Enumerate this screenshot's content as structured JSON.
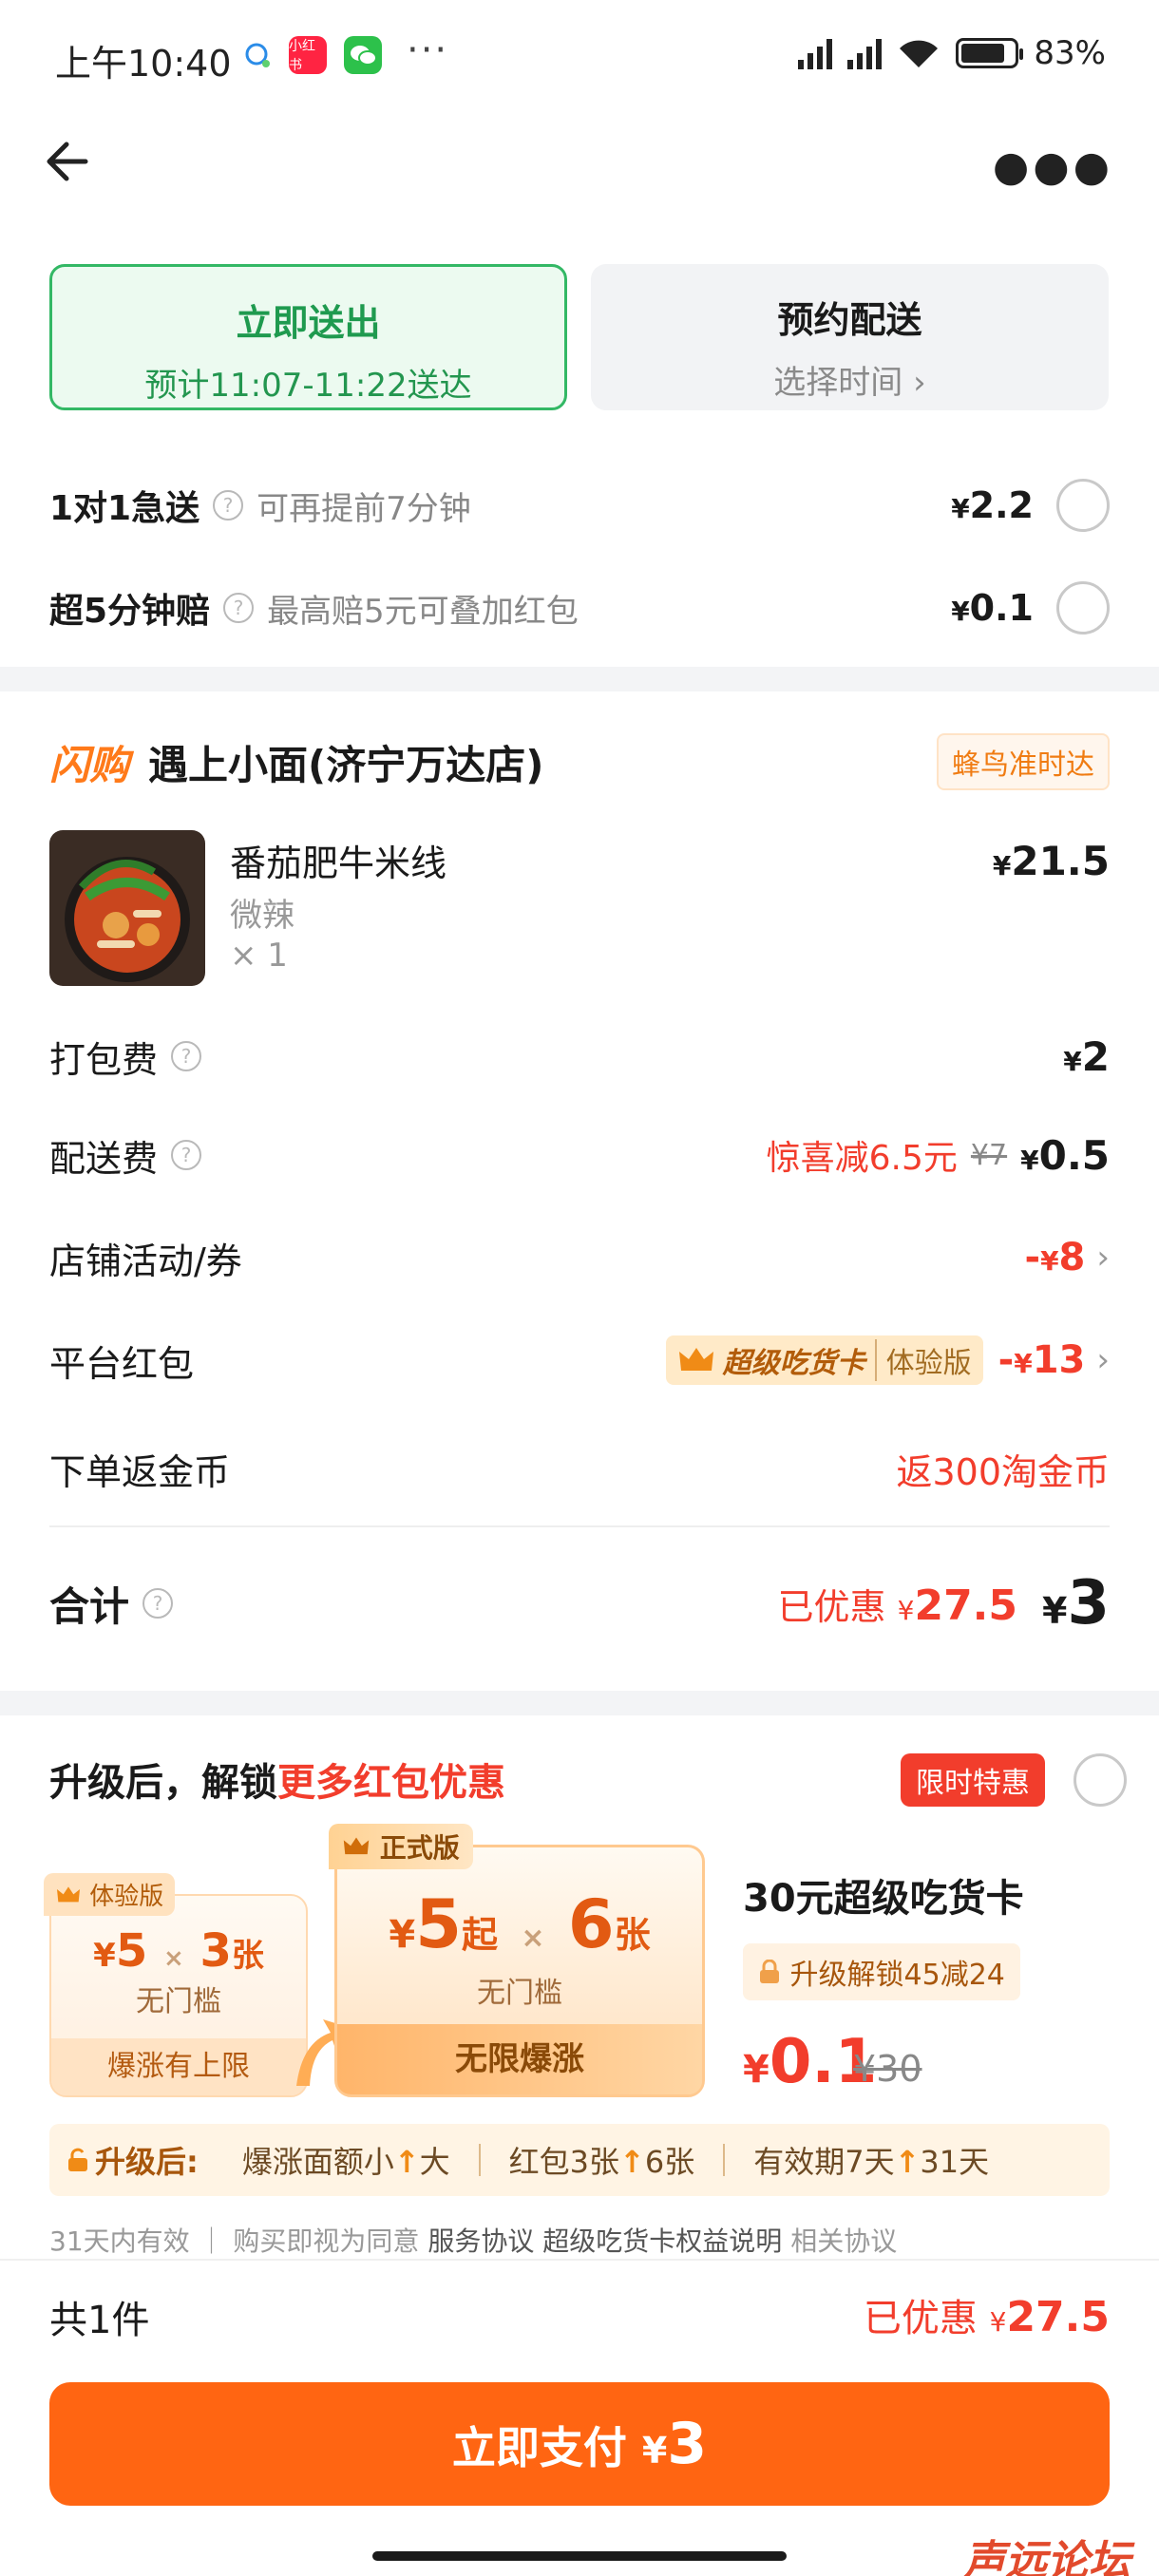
{
  "status_bar": {
    "time": "上午10:40",
    "battery": "83%",
    "battery_level": 0.83,
    "dots": "···",
    "app_xiaohongshu": "小红书"
  },
  "delivery": {
    "now": {
      "title": "立即送出",
      "subtitle": "预计11:07-11:22送达"
    },
    "scheduled": {
      "title": "预约配送",
      "subtitle": "选择时间"
    }
  },
  "options": [
    {
      "label": "1对1急送",
      "desc": "可再提前7分钟",
      "price": "2.2"
    },
    {
      "label": "超5分钟赔",
      "desc": "最高赔5元可叠加红包",
      "price": "0.1"
    }
  ],
  "store": {
    "logo": "闪购",
    "name": "遇上小面(济宁万达店)",
    "tag": "蜂鸟准时达"
  },
  "item": {
    "name": "番茄肥牛米线",
    "spec": "微辣",
    "qty": "× 1",
    "price": "21.5"
  },
  "fees": {
    "packing": {
      "label": "打包费",
      "price": "2"
    },
    "delivery": {
      "label": "配送费",
      "discount": "惊喜减6.5元",
      "original": "¥7",
      "price": "0.5"
    },
    "store_promo": {
      "label": "店铺活动/券",
      "value": "8"
    },
    "platform": {
      "label": "平台红包",
      "card": "超级吃货卡",
      "trial": "体验版",
      "value": "13"
    },
    "coins": {
      "label": "下单返金币",
      "value": "返300淘金币"
    }
  },
  "summary": {
    "label": "合计",
    "saved_label": "已优惠",
    "saved": "27.5",
    "total": "3"
  },
  "upgrade": {
    "title_prefix": "升级后，解锁",
    "title_highlight": "更多红包优惠",
    "limited": "限时特惠",
    "trial_card": {
      "badge": "体验版",
      "amount": "5",
      "times": "×",
      "count": "3",
      "unit": "张",
      "threshold": "无门槛",
      "footer": "爆涨有上限"
    },
    "full_card": {
      "badge": "正式版",
      "amount": "5",
      "from": "起",
      "times": "×",
      "count": "6",
      "unit": "张",
      "threshold": "无门槛",
      "footer": "无限爆涨"
    },
    "product": {
      "title": "30元超级吃货卡",
      "unlock": "升级解锁45减24",
      "price": "0.1",
      "original": "¥30"
    },
    "after": {
      "label": "升级后:",
      "items": [
        {
          "pre": "爆涨面额小",
          "post": "大"
        },
        {
          "pre": "红包3张",
          "post": "6张"
        },
        {
          "pre": "有效期7天",
          "post": "31天"
        }
      ]
    },
    "agreement": {
      "prefix": "31天内有效 ｜ 购买即视为同意",
      "link1": "服务协议",
      "link2": "超级吃货卡权益说明",
      "link3": "相关协议"
    }
  },
  "bottom": {
    "count": "共1件",
    "saved_label": "已优惠",
    "saved": "27.5",
    "pay_label": "立即支付",
    "pay_amount": "3"
  },
  "currency": "¥",
  "watermark": "声远论坛",
  "colors": {
    "green": "#33b865",
    "orange": "#ff6512",
    "red": "#f23d2c"
  }
}
